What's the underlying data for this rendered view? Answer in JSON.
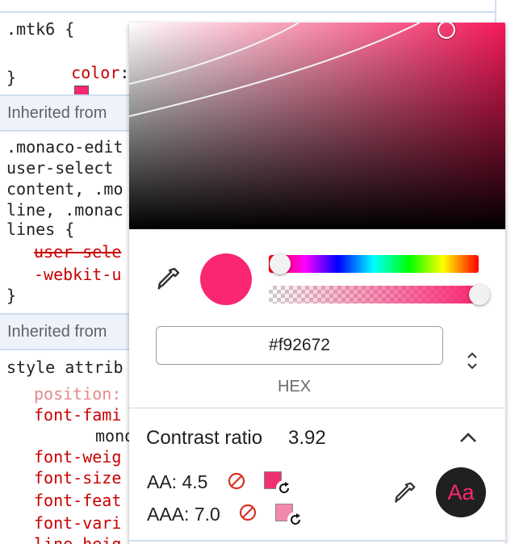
{
  "styles": {
    "selector1": ".mtk6 {",
    "color_prop": "color",
    "color_colon": ":",
    "close_brace": "}",
    "inherited_from_1": "Inherited from",
    "monaco_lines": [
      ".monaco-edit",
      "user-select",
      "content, .mo",
      "line, .monac",
      "lines {"
    ],
    "user_select_prop": "user-sele",
    "webkit_user_prop": "-webkit-u",
    "inherited_from_2": "Inherited from",
    "style_attribute": "style attrib",
    "position_prop": "position:",
    "font_family_prop": "font-fami",
    "mono_value": "mono",
    "font_weight_prop": "font-weig",
    "font_size_prop": "font-size",
    "font_feature_prop": "font-feat",
    "font_variation_prop": "font-vari",
    "line_height_prop": "line-heig"
  },
  "picker": {
    "current_color": "#f92672",
    "hex_value": "#f92672",
    "format_label": "HEX",
    "contrast_title": "Contrast ratio",
    "contrast_value": "3.92",
    "aa_label": "AA: 4.5",
    "aaa_label": "AAA: 7.0",
    "aa_fix_color": "#f0316f",
    "aaa_fix_color": "#f289ac",
    "preview_text": "Aa",
    "preview_bg": "#202020"
  },
  "icons": {
    "eyedropper": "eyedropper-icon",
    "format_toggle": "up-down-chevron-icon",
    "collapse": "chevron-up-icon",
    "no_pass": "no-entry-icon",
    "refresh": "refresh-icon"
  }
}
